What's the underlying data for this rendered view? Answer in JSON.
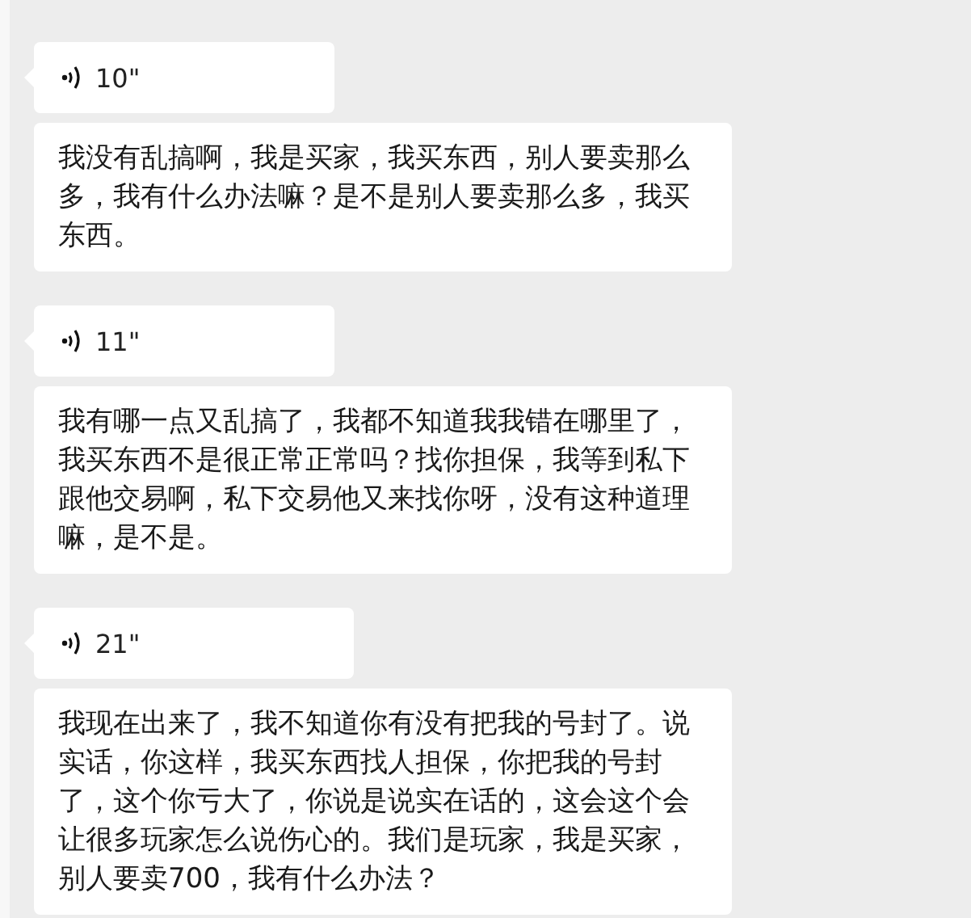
{
  "messages": [
    {
      "voice": {
        "duration": "10\""
      },
      "text": "我没有乱搞啊，我是买家，我买东西，别人要卖那么多，我有什么办法嘛？是不是别人要卖那么多，我买东西。"
    },
    {
      "voice": {
        "duration": "11\""
      },
      "text": "我有哪一点又乱搞了，我都不知道我我错在哪里了，我买东西不是很正常正常吗？找你担保，我等到私下跟他交易啊，私下交易他又来找你呀，没有这种道理嘛，是不是。"
    },
    {
      "voice": {
        "duration": "21\""
      },
      "text": "我现在出来了，我不知道你有没有把我的号封了。说实话，你这样，我买东西找人担保，你把我的号封了，这个你亏大了，你说是说实在话的，这会这个会让很多玩家怎么说伤心的。我们是玩家，我是买家，别人要卖700，我有什么办法？"
    }
  ]
}
